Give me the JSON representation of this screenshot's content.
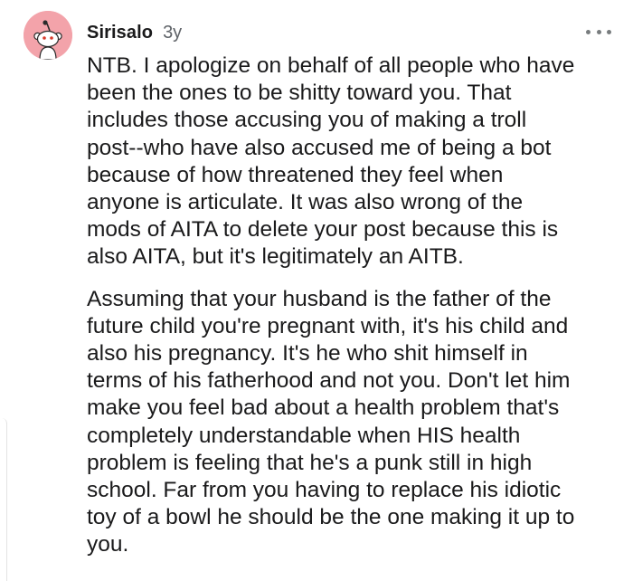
{
  "comment": {
    "author": "Sirisalo",
    "age": "3y",
    "menu_icon": "more-horizontal-icon",
    "avatar_icon": "snoo-avatar-icon",
    "colors": {
      "avatar_background": "#f3a3aa",
      "text": "#1a1a1b",
      "meta": "#5f6368"
    },
    "paragraphs": [
      "NTB. I apologize on behalf of all people who have\nbeen the ones to be shitty toward you. That\nincludes those accusing you of making a troll\npost--who have also accused me of being a bot\nbecause of how threatened they feel when\nanyone is articulate. It was also wrong of the\nmods of AITA to delete your post because this is\nalso AITA, but it's legitimately an AITB.",
      "Assuming that your husband is the father of the\nfuture child you're pregnant with, it's his child and\nalso his pregnancy. It's he who shit himself in\nterms of his fatherhood and not you. Don't let him\nmake you feel bad about a health problem that's\ncompletely understandable when HIS health\nproblem is feeling that he's a punk still in high\nschool. Far from you having to replace his idiotic\ntoy of a bowl he should be the one making it up to\nyou."
    ]
  }
}
